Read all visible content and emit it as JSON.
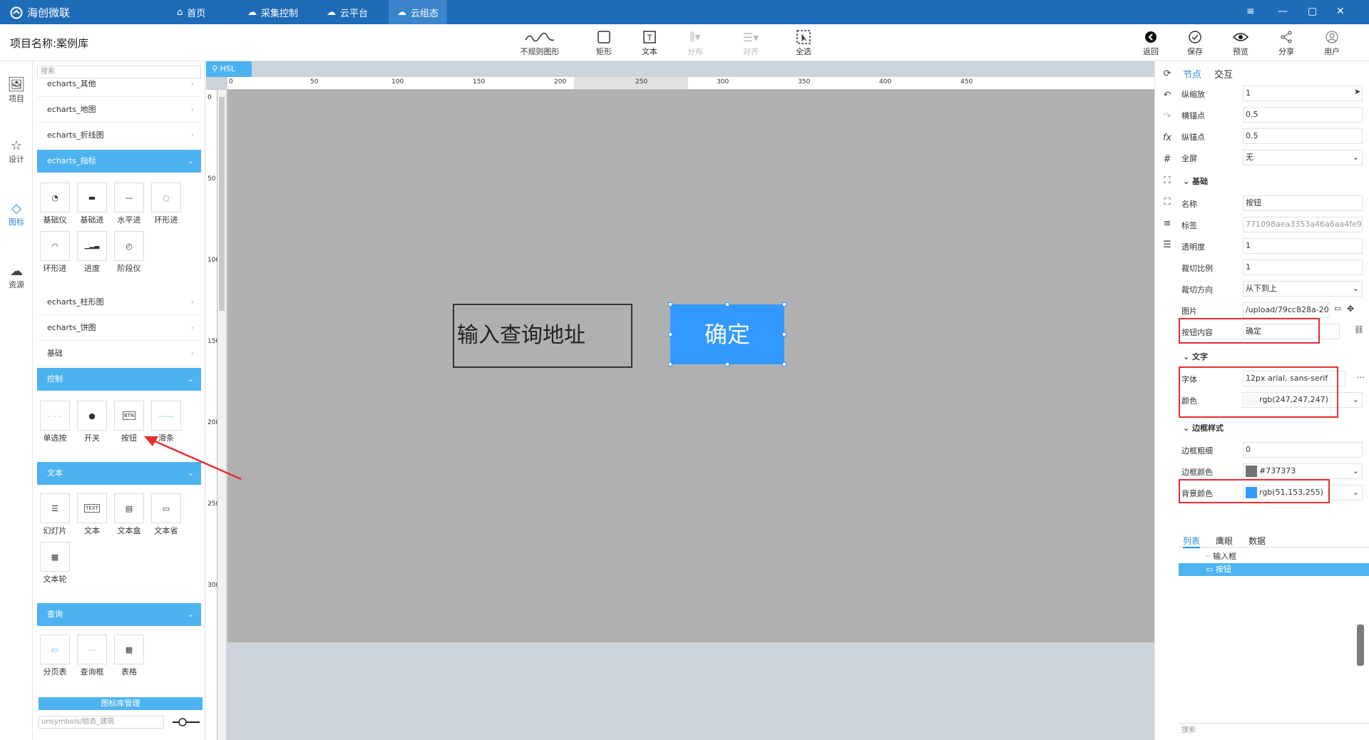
{
  "app": {
    "title": "海创微联"
  },
  "nav": [
    {
      "label": "首页",
      "icon": "home-icon"
    },
    {
      "label": "采集控制",
      "icon": "cloud-control-icon"
    },
    {
      "label": "云平台",
      "icon": "cloud-platform-icon"
    },
    {
      "label": "云组态",
      "icon": "cloud-config-icon"
    }
  ],
  "project": {
    "name_label": "项目名称:",
    "name": "案例库"
  },
  "toolbar": {
    "irregular": "不规则图形",
    "rect": "矩形",
    "text": "文本",
    "distribute": "分布",
    "align": "对齐",
    "select_all": "全选"
  },
  "actions": {
    "back": "返回",
    "save": "保存",
    "preview": "预览",
    "share": "分享",
    "user": "用户"
  },
  "leftnav": {
    "project": "项目",
    "design": "设计",
    "chart": "图标",
    "resource": "资源"
  },
  "library": {
    "search_placeholder": "搜索",
    "rows_top": [
      "echarts_其他",
      "echarts_地图",
      "echarts_折线图"
    ],
    "head_indicator": "echarts_指标",
    "indicator_items": [
      "基础仪",
      "基础进",
      "水平进",
      "环形进",
      "环形进",
      "进度",
      "阶段仪"
    ],
    "rows_mid": [
      "echarts_柱形图",
      "echarts_饼图",
      "基础"
    ],
    "head_control": "控制",
    "control_items": [
      "单选按",
      "开关",
      "按钮",
      "滑条"
    ],
    "head_text": "文本",
    "text_items": [
      "幻灯片",
      "文本",
      "文本盒",
      "文本省",
      "文本轮"
    ],
    "head_query": "查询",
    "query_items": [
      "分页表",
      "查询框",
      "表格"
    ],
    "mgmt": "图标库管理",
    "path_placeholder": "unsymbols/组态_建筑"
  },
  "canvas": {
    "tab": "HSL",
    "ruler_h": [
      "0",
      "50",
      "100",
      "150",
      "200",
      "250",
      "300",
      "350",
      "400",
      "450"
    ],
    "ruler_v": [
      "0",
      "50",
      "100",
      "150",
      "200",
      "250",
      "300"
    ],
    "input_text": "输入查询地址",
    "button_text": "确定"
  },
  "props": {
    "tab_node": "节点",
    "tab_interact": "交互",
    "fields_top": [
      {
        "label": "纵缩放",
        "value": "1"
      },
      {
        "label": "横锚点",
        "value": "0.5"
      },
      {
        "label": "纵锚点",
        "value": "0.5"
      },
      {
        "label": "全屏",
        "value": "无"
      }
    ],
    "sec_basic": "基础",
    "fields_basic": [
      {
        "label": "名称",
        "value": "按钮"
      },
      {
        "label": "标签",
        "value": "771098aea3353a46a6aa4fe98"
      },
      {
        "label": "透明度",
        "value": "1"
      },
      {
        "label": "裁切比例",
        "value": "1"
      },
      {
        "label": "裁切方向",
        "value": "从下到上"
      },
      {
        "label": "图片",
        "value": "/upload/79cc828a-20f"
      },
      {
        "label": "按钮内容",
        "value": "确定"
      }
    ],
    "sec_text": "文字",
    "font_label": "字体",
    "font_value": "12px arial, sans-serif",
    "color_label": "颜色",
    "color_value": "rgb(247,247,247)",
    "sec_border": "边框样式",
    "border_width_label": "边框粗细",
    "border_width": "0",
    "border_color_label": "边框颜色",
    "border_color": "#737373",
    "bg_label": "背景颜色",
    "bg_value": "rgb(51,153,255)",
    "tree_tabs": [
      "列表",
      "鹰眼",
      "数据"
    ],
    "tree_items": [
      "输入框",
      "按钮"
    ],
    "search_placeholder": "搜索"
  }
}
